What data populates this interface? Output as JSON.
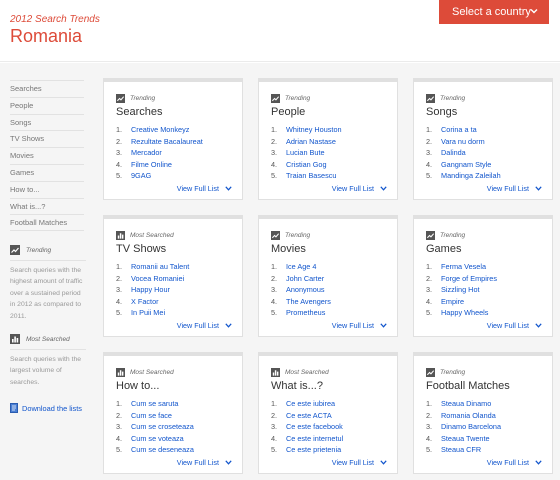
{
  "header": {
    "year_title": "2012 Search Trends",
    "country": "Romania",
    "select_button": "Select a country"
  },
  "sidebar": {
    "items": [
      "Searches",
      "People",
      "Songs",
      "TV Shows",
      "Movies",
      "Games",
      "How to...",
      "What is...?",
      "Football Matches"
    ],
    "legend_trending": {
      "label": "Trending",
      "description": "Search queries with the highest amount of traffic over a sustained period in 2012 as compared to 2011."
    },
    "legend_most": {
      "label": "Most Searched",
      "description": "Search queries with the largest volume of searches."
    },
    "download": "Download the lists"
  },
  "cards": [
    {
      "type": "Trending",
      "title": "Searches",
      "items": [
        "Creative Monkeyz",
        "Rezultate Bacalaureat",
        "Mercador",
        "Filme Online",
        "9GAG"
      ]
    },
    {
      "type": "Trending",
      "title": "People",
      "items": [
        "Whitney Houston",
        "Adrian Nastase",
        "Lucian Bute",
        "Cristian Gog",
        "Traian Basescu"
      ]
    },
    {
      "type": "Trending",
      "title": "Songs",
      "items": [
        "Corina a ta",
        "Vara nu dorm",
        "Dalinda",
        "Gangnam Style",
        "Mandinga Zaleilah"
      ]
    },
    {
      "type": "Most Searched",
      "title": "TV Shows",
      "items": [
        "Romanii au Talent",
        "Vocea Romaniei",
        "Happy Hour",
        "X Factor",
        "In Puii Mei"
      ]
    },
    {
      "type": "Trending",
      "title": "Movies",
      "items": [
        "Ice Age 4",
        "John Carter",
        "Anonymous",
        "The Avengers",
        "Prometheus"
      ]
    },
    {
      "type": "Trending",
      "title": "Games",
      "items": [
        "Ferma Vesela",
        "Forge of Empires",
        "Sizzling Hot",
        "Empire",
        "Happy Wheels"
      ]
    },
    {
      "type": "Most Searched",
      "title": "How to...",
      "items": [
        "Cum se saruta",
        "Cum se face",
        "Cum se croseteaza",
        "Cum se voteaza",
        "Cum se deseneaza"
      ]
    },
    {
      "type": "Most Searched",
      "title": "What is...?",
      "items": [
        "Ce este iubirea",
        "Ce este ACTA",
        "Ce este facebook",
        "Ce este internetul",
        "Ce este prietenia"
      ]
    },
    {
      "type": "Trending",
      "title": "Football Matches",
      "items": [
        "Steaua Dinamo",
        "Romania Olanda",
        "Dinamo Barcelona",
        "Steaua Twente",
        "Steaua CFR"
      ]
    }
  ],
  "view_full_list": "View Full List",
  "colors": {
    "accent": "#dd4b39",
    "link": "#1155cc"
  }
}
